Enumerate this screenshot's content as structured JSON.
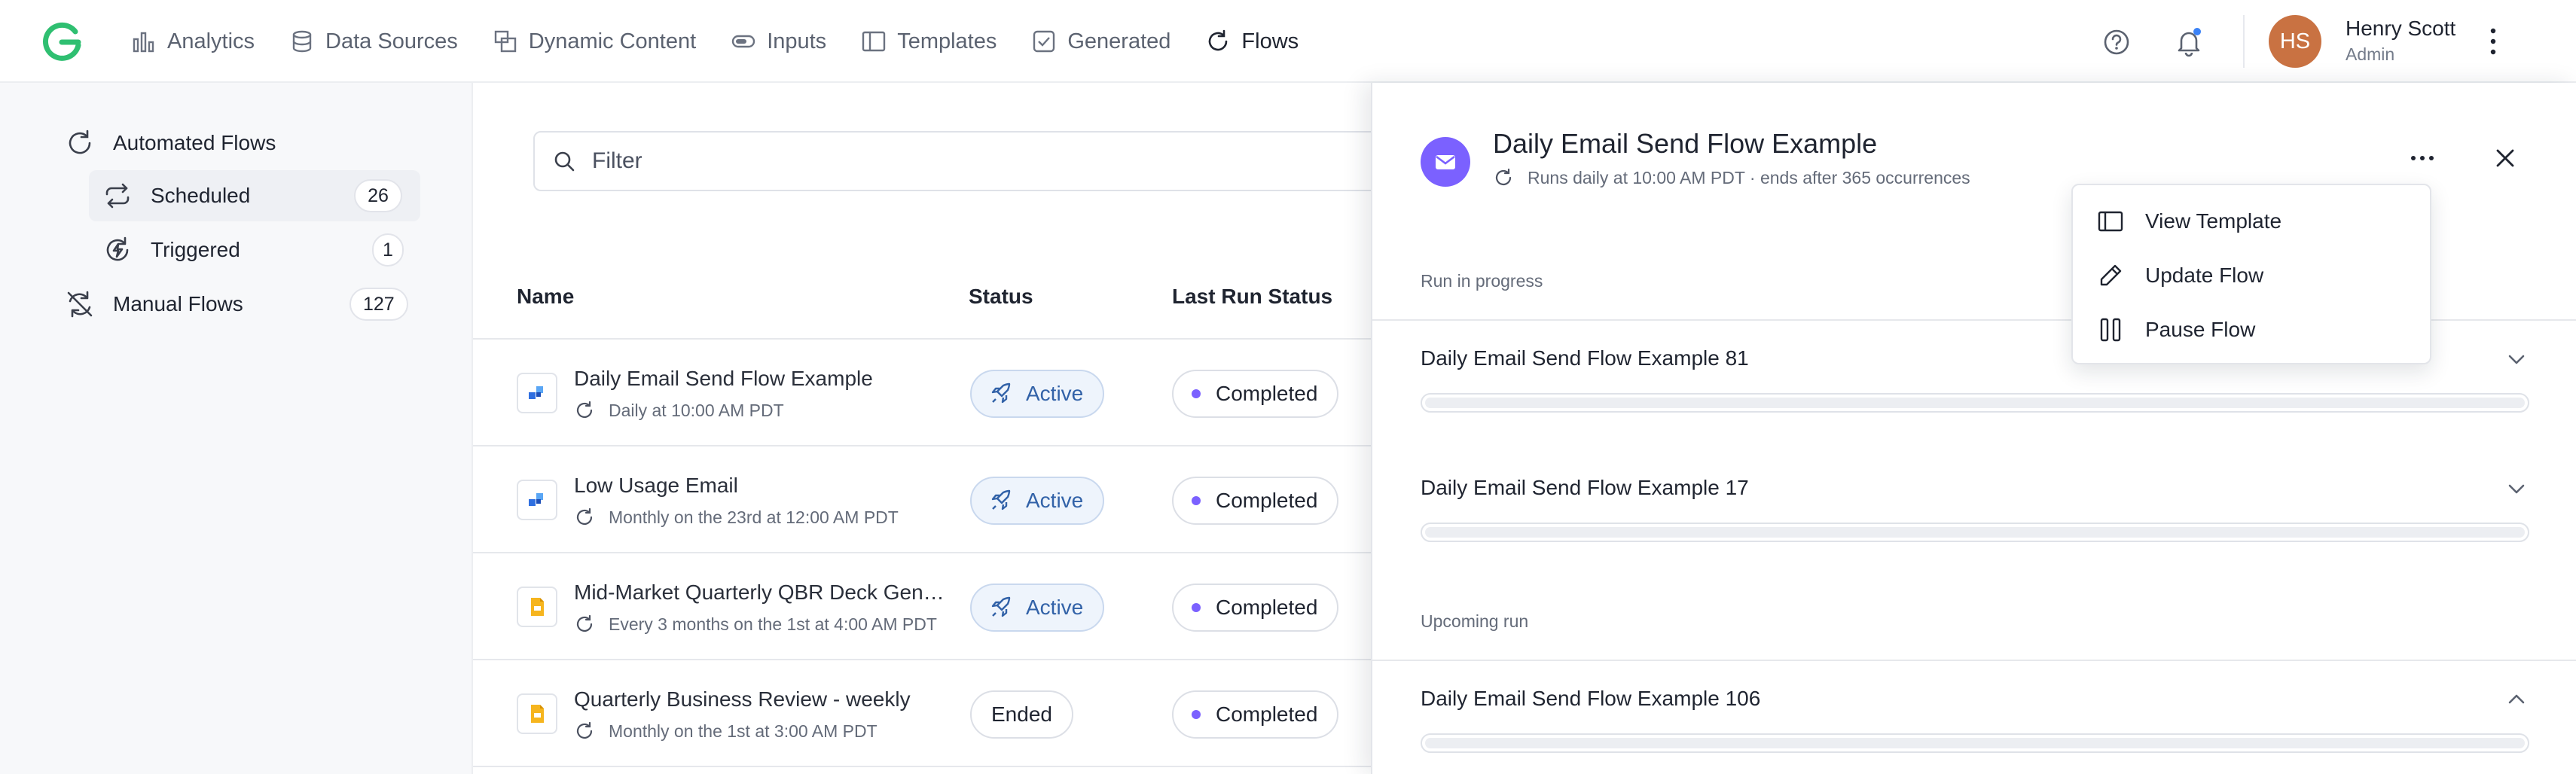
{
  "nav": {
    "items": [
      {
        "label": "Analytics",
        "icon": "analytics-icon",
        "active": false
      },
      {
        "label": "Data Sources",
        "icon": "database-icon",
        "active": false
      },
      {
        "label": "Dynamic Content",
        "icon": "dynamic-content-icon",
        "active": false
      },
      {
        "label": "Inputs",
        "icon": "toggle-icon",
        "active": false
      },
      {
        "label": "Templates",
        "icon": "template-icon",
        "active": false
      },
      {
        "label": "Generated",
        "icon": "check-square-icon",
        "active": false
      },
      {
        "label": "Flows",
        "icon": "refresh-icon",
        "active": true
      }
    ]
  },
  "user": {
    "initials": "HS",
    "name": "Henry Scott",
    "role": "Admin",
    "avatar_color": "#c97242"
  },
  "sidebar": {
    "automated": {
      "label": "Automated Flows"
    },
    "scheduled": {
      "label": "Scheduled",
      "count": "26"
    },
    "triggered": {
      "label": "Triggered",
      "count": "1"
    },
    "manual": {
      "label": "Manual Flows",
      "count": "127"
    }
  },
  "filter": {
    "placeholder": "Filter",
    "value": ""
  },
  "table": {
    "headers": {
      "name": "Name",
      "status": "Status",
      "last_run": "Last Run Status"
    },
    "rows": [
      {
        "name": "Daily Email Send Flow Example",
        "schedule": "Daily at 10:00 AM PDT",
        "status": "Active",
        "last_run": "Completed",
        "icon": "email-app-icon"
      },
      {
        "name": "Low Usage Email",
        "schedule": "Monthly on the 23rd at 12:00 AM PDT",
        "status": "Active",
        "last_run": "Completed",
        "icon": "email-app-icon"
      },
      {
        "name": "Mid-Market Quarterly QBR Deck Generation",
        "schedule": "Every 3 months on the 1st at 4:00 AM PDT",
        "status": "Active",
        "last_run": "Completed",
        "icon": "slides-icon"
      },
      {
        "name": "Quarterly Business Review - weekly",
        "schedule": "Monthly on the 1st at 3:00 AM PDT",
        "status": "Ended",
        "last_run": "Completed",
        "icon": "slides-icon"
      }
    ]
  },
  "drawer": {
    "title": "Daily Email Send Flow Example",
    "subtitle": "Runs daily at 10:00 AM PDT · ends after 365 occurrences",
    "in_progress_label": "Run in progress",
    "upcoming_label": "Upcoming run",
    "runs": [
      {
        "name": "Daily Email Send Flow Example 81",
        "expanded": false
      },
      {
        "name": "Daily Email Send Flow Example 17",
        "expanded": false
      },
      {
        "name": "Daily Email Send Flow Example 106",
        "expanded": true
      }
    ]
  },
  "menu": {
    "items": [
      {
        "label": "View Template",
        "icon": "panel-icon"
      },
      {
        "label": "Update Flow",
        "icon": "pencil-icon"
      },
      {
        "label": "Pause Flow",
        "icon": "pause-icon"
      }
    ]
  },
  "colors": {
    "accent": "#7b61ff",
    "active_pill": "#3262a8",
    "brand": "#2fbf71"
  }
}
